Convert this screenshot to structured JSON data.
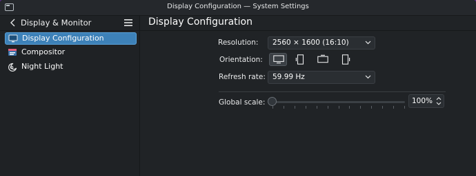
{
  "window": {
    "title": "Display Configuration — System Settings"
  },
  "sidebar": {
    "title": "Display & Monitor",
    "items": [
      {
        "label": "Display Configuration",
        "icon": "monitor-icon",
        "active": true
      },
      {
        "label": "Compositor",
        "icon": "compositor-icon",
        "active": false
      },
      {
        "label": "Night Light",
        "icon": "night-light-icon",
        "active": false
      }
    ]
  },
  "main": {
    "title": "Display Configuration",
    "resolution": {
      "label": "Resolution:",
      "value": "2560 × 1600 (16:10)"
    },
    "orientation": {
      "label": "Orientation:",
      "options": [
        "landscape",
        "portrait",
        "landscape-flipped",
        "portrait-flipped"
      ],
      "selected": "landscape"
    },
    "refresh_rate": {
      "label": "Refresh rate:",
      "value": "59.99 Hz"
    },
    "global_scale": {
      "label": "Global scale:",
      "value": "100%",
      "slider_fraction": 0.0
    }
  },
  "colors": {
    "accent": "#3d81b8",
    "background": "#202326",
    "desktop": "#5b2a86"
  }
}
